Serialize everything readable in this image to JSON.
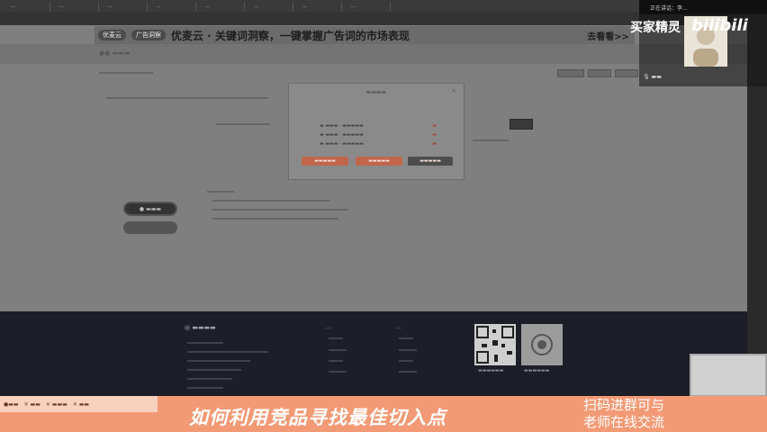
{
  "browser": {
    "tabs": [
      "...",
      "...",
      "...",
      "...",
      "...",
      "...",
      "...",
      "..."
    ]
  },
  "banner": {
    "pill1": "优麦云",
    "pill2": "广告洞察",
    "headline": "优麦云 · 关键词洞察，一键掌握广告词的市场表现",
    "cta": "去看看>>"
  },
  "modal": {
    "close": "×"
  },
  "footer": {
    "col1_title": "...",
    "col2_title": "...",
    "col3_title": "..."
  },
  "stream": {
    "topbar": "正在讲话：李..."
  },
  "overlay": {
    "side_label": "买家精灵",
    "logo": "bilibili"
  },
  "promo": {
    "title": "如何利用竞品寻找最佳切入点",
    "right_line1": "扫码进群可与",
    "right_line2": "老师在线交流"
  }
}
